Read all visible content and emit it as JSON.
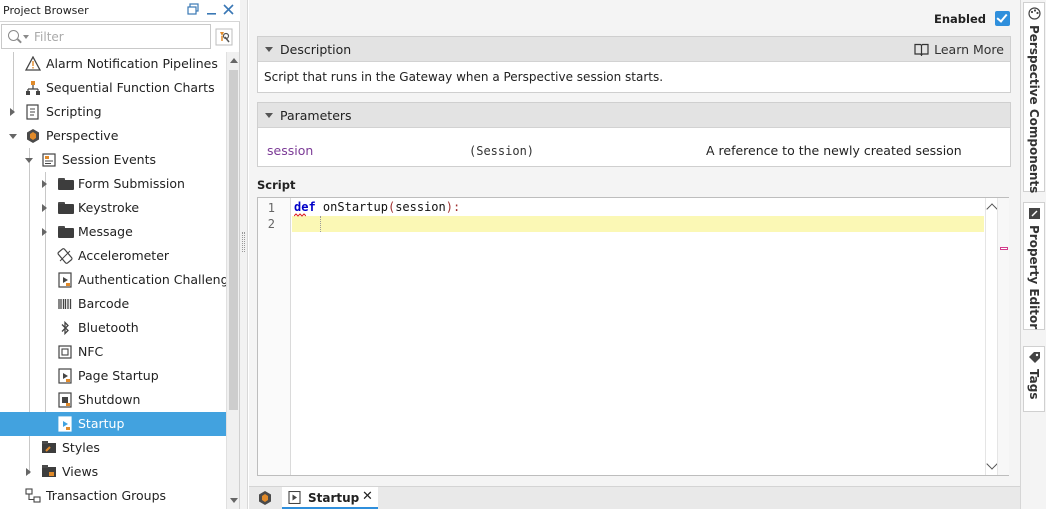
{
  "project_browser": {
    "title": "Project Browser",
    "filter_placeholder": "Filter",
    "tree": [
      {
        "label": "Alarm Notification Pipelines",
        "icon": "alarm-pipeline-icon"
      },
      {
        "label": "Sequential Function Charts",
        "icon": "sfc-icon"
      },
      {
        "label": "Scripting",
        "icon": "scripting-icon"
      },
      {
        "label": "Perspective",
        "icon": "perspective-icon"
      },
      {
        "label": "Session Events",
        "icon": "session-events-icon"
      },
      {
        "label": "Form Submission",
        "icon": "folder-icon"
      },
      {
        "label": "Keystroke",
        "icon": "folder-icon"
      },
      {
        "label": "Message",
        "icon": "folder-icon"
      },
      {
        "label": "Accelerometer",
        "icon": "accelerometer-icon"
      },
      {
        "label": "Authentication Challenge",
        "icon": "script-icon"
      },
      {
        "label": "Barcode",
        "icon": "barcode-icon"
      },
      {
        "label": "Bluetooth",
        "icon": "bluetooth-icon"
      },
      {
        "label": "NFC",
        "icon": "nfc-icon"
      },
      {
        "label": "Page Startup",
        "icon": "script-icon"
      },
      {
        "label": "Shutdown",
        "icon": "script-icon"
      },
      {
        "label": "Startup",
        "icon": "script-icon",
        "selected": true
      },
      {
        "label": "Styles",
        "icon": "styles-icon"
      },
      {
        "label": "Views",
        "icon": "views-icon"
      },
      {
        "label": "Transaction Groups",
        "icon": "transaction-groups-icon"
      }
    ]
  },
  "editor": {
    "enabled_label": "Enabled",
    "enabled": true,
    "description": {
      "header": "Description",
      "learn_more": "Learn More",
      "text": "Script that runs in the Gateway when a Perspective session starts."
    },
    "parameters": {
      "header": "Parameters",
      "rows": [
        {
          "name": "session",
          "type": "(Session)",
          "description": "A reference to the newly created session"
        }
      ]
    },
    "script_label": "Script",
    "code": {
      "line_numbers": [
        "1",
        "2"
      ],
      "keyword": "def",
      "function_name": "onStartup",
      "open_paren": "(",
      "param": "session",
      "close": "):"
    }
  },
  "tabs": {
    "active": "Startup"
  },
  "dock": {
    "tabs": [
      "Perspective Components",
      "Property Editor",
      "Tags"
    ]
  },
  "colors": {
    "selection": "#42a2df",
    "accent": "#2f8fdc",
    "current_line": "#fbf8b5",
    "param_name": "#7b3a96",
    "keyword": "#0000c8"
  }
}
